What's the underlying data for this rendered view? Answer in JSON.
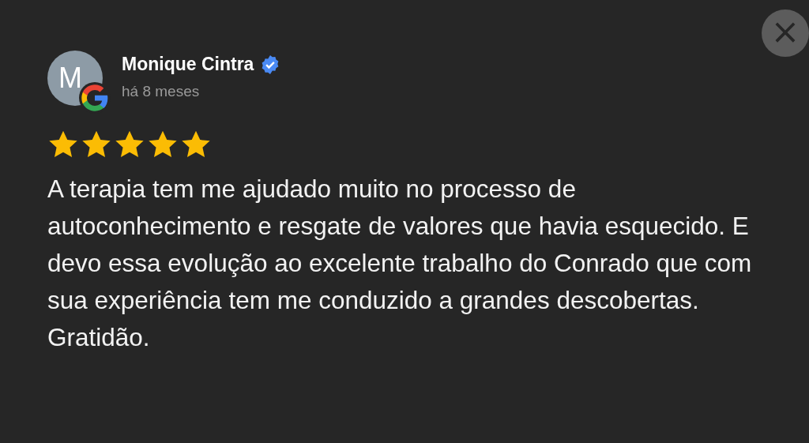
{
  "review": {
    "avatar_initial": "M",
    "author": "Monique Cintra",
    "verified": true,
    "time": "há 8 meses",
    "stars": 5,
    "text": "A terapia tem me ajudado muito no processo de autoconhecimento e resgate de valores que havia esquecido. E devo essa evolução ao excelente trabalho do Conrado que com sua experiência tem me conduzido a grandes descobertas. Gratidão."
  },
  "close_button": {
    "label": "×"
  }
}
